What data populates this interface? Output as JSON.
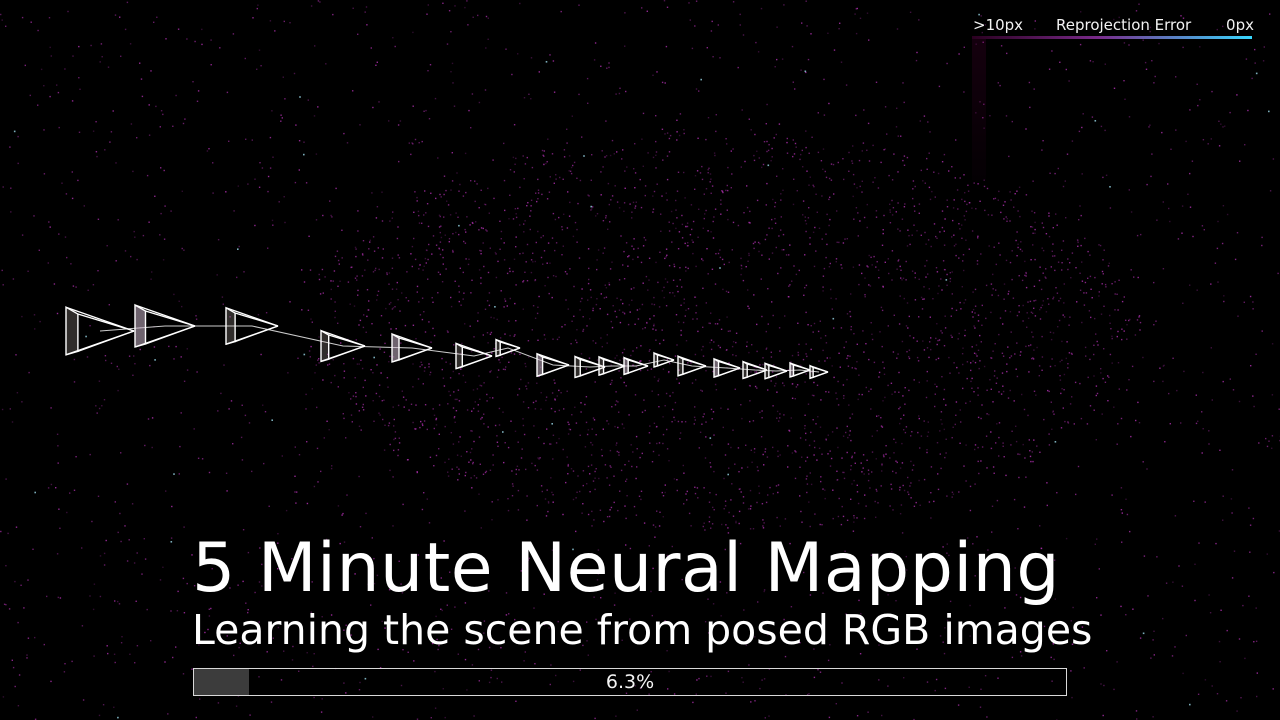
{
  "legend": {
    "high_label": ">10px",
    "title": "Reprojection Error",
    "low_label": "0px",
    "color_high": "#2a0020",
    "color_mid": "#7a2a8a",
    "color_low": "#38d8ff"
  },
  "overlay": {
    "title": "5 Minute Neural Mapping",
    "subtitle": "Learning the scene from posed RGB images"
  },
  "progress": {
    "label": "6.3%",
    "fraction": 0.063
  },
  "scene": {
    "point_color": "#b030b0",
    "highlight_point_color": "#9ad8e8",
    "camera_color": "#ffffff"
  }
}
